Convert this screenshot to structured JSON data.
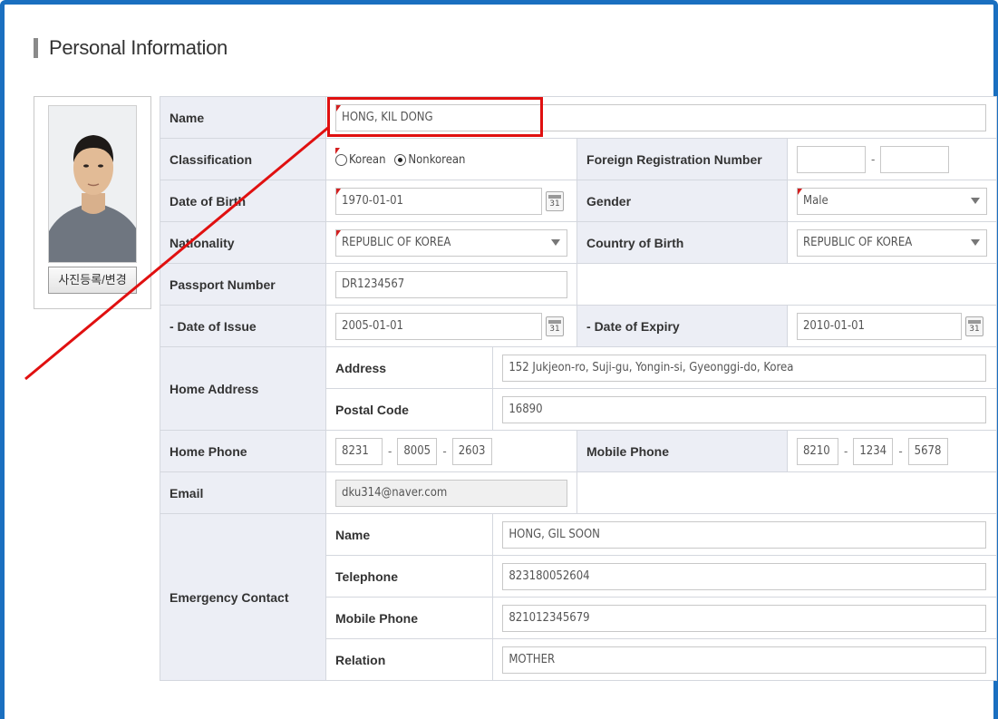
{
  "page": {
    "title": "Personal Information"
  },
  "photo": {
    "button_label": "사진등록/변경"
  },
  "fields": {
    "name": {
      "label": "Name",
      "value": "HONG, KIL DONG"
    },
    "classification": {
      "label": "Classification",
      "options": [
        "Korean",
        "Nonkorean"
      ],
      "selected": "Nonkorean"
    },
    "foreign_reg": {
      "label": "Foreign Registration Number",
      "part1": "",
      "part2": ""
    },
    "dob": {
      "label": "Date of Birth",
      "value": "1970-01-01"
    },
    "gender": {
      "label": "Gender",
      "value": "Male"
    },
    "nationality": {
      "label": "Nationality",
      "value": "REPUBLIC OF KOREA"
    },
    "country_of_birth": {
      "label": "Country of Birth",
      "value": "REPUBLIC OF KOREA"
    },
    "passport": {
      "label": "Passport Number",
      "value": "DR1234567"
    },
    "issue": {
      "label": "- Date of Issue",
      "value": "2005-01-01"
    },
    "expiry": {
      "label": "- Date of Expiry",
      "value": "2010-01-01"
    },
    "home_address": {
      "label": "Home Address",
      "address_label": "Address",
      "address_value": "152 Jukjeon-ro, Suji-gu, Yongin-si, Gyeonggi-do, Korea",
      "postal_label": "Postal Code",
      "postal_value": "16890"
    },
    "home_phone": {
      "label": "Home Phone",
      "p1": "8231",
      "p2": "8005",
      "p3": "2603"
    },
    "mobile_phone": {
      "label": "Mobile Phone",
      "p1": "8210",
      "p2": "1234",
      "p3": "5678"
    },
    "email": {
      "label": "Email",
      "value": "dku314@naver.com"
    },
    "emergency": {
      "label": "Emergency Contact",
      "name_label": "Name",
      "name_value": "HONG, GIL SOON",
      "tel_label": "Telephone",
      "tel_value": "823180052604",
      "mobile_label": "Mobile Phone",
      "mobile_value": "821012345679",
      "relation_label": "Relation",
      "relation_value": "MOTHER"
    }
  },
  "calendar_icon_text": "31",
  "dash": "-",
  "colors": {
    "frame": "#1a6fc0",
    "label_bg": "#eceef5",
    "highlight": "#e01010",
    "required": "#d42020"
  }
}
